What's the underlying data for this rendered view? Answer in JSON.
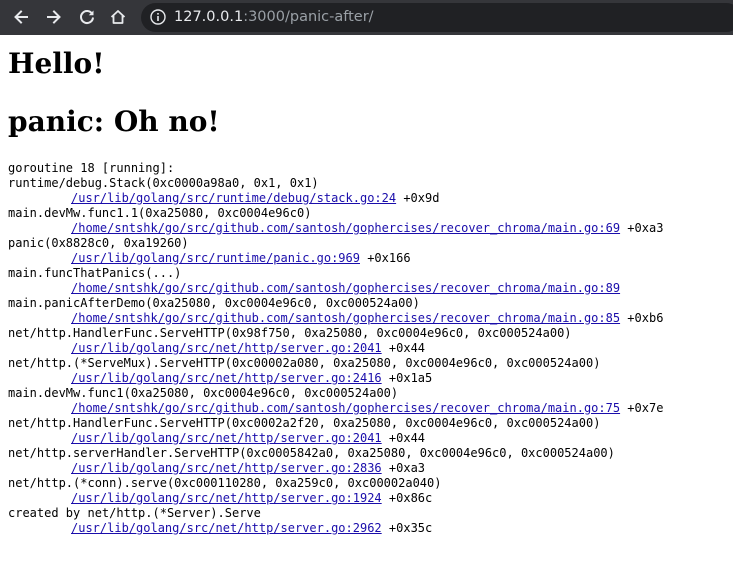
{
  "browser": {
    "url_host": "127.0.0.1",
    "url_rest": ":3000/panic-after/",
    "icons": {
      "back": "back-arrow-icon",
      "forward": "forward-arrow-icon",
      "reload": "reload-icon",
      "home": "home-icon",
      "site_info": "info-icon"
    }
  },
  "page": {
    "heading1": "Hello!",
    "heading2": "panic: Oh no!",
    "trace_header": "goroutine 18 [running]:",
    "frames": [
      {
        "func": "runtime/debug.Stack(0xc0000a98a0, 0x1, 0x1)",
        "file": "/usr/lib/golang/src/runtime/debug/stack.go:24",
        "offset": "+0x9d"
      },
      {
        "func": "main.devMw.func1.1(0xa25080, 0xc0004e96c0)",
        "file": "/home/sntshk/go/src/github.com/santosh/gophercises/recover_chroma/main.go:69",
        "offset": "+0xa3"
      },
      {
        "func": "panic(0x8828c0, 0xa19260)",
        "file": "/usr/lib/golang/src/runtime/panic.go:969",
        "offset": "+0x166"
      },
      {
        "func": "main.funcThatPanics(...)",
        "file": "/home/sntshk/go/src/github.com/santosh/gophercises/recover_chroma/main.go:89",
        "offset": ""
      },
      {
        "func": "main.panicAfterDemo(0xa25080, 0xc0004e96c0, 0xc000524a00)",
        "file": "/home/sntshk/go/src/github.com/santosh/gophercises/recover_chroma/main.go:85",
        "offset": "+0xb6"
      },
      {
        "func": "net/http.HandlerFunc.ServeHTTP(0x98f750, 0xa25080, 0xc0004e96c0, 0xc000524a00)",
        "file": "/usr/lib/golang/src/net/http/server.go:2041",
        "offset": "+0x44"
      },
      {
        "func": "net/http.(*ServeMux).ServeHTTP(0xc00002a080, 0xa25080, 0xc0004e96c0, 0xc000524a00)",
        "file": "/usr/lib/golang/src/net/http/server.go:2416",
        "offset": "+0x1a5"
      },
      {
        "func": "main.devMw.func1(0xa25080, 0xc0004e96c0, 0xc000524a00)",
        "file": "/home/sntshk/go/src/github.com/santosh/gophercises/recover_chroma/main.go:75",
        "offset": "+0x7e"
      },
      {
        "func": "net/http.HandlerFunc.ServeHTTP(0xc0002a2f20, 0xa25080, 0xc0004e96c0, 0xc000524a00)",
        "file": "/usr/lib/golang/src/net/http/server.go:2041",
        "offset": "+0x44"
      },
      {
        "func": "net/http.serverHandler.ServeHTTP(0xc0005842a0, 0xa25080, 0xc0004e96c0, 0xc000524a00)",
        "file": "/usr/lib/golang/src/net/http/server.go:2836",
        "offset": "+0xa3"
      },
      {
        "func": "net/http.(*conn).serve(0xc000110280, 0xa259c0, 0xc00002a040)",
        "file": "/usr/lib/golang/src/net/http/server.go:1924",
        "offset": "+0x86c"
      },
      {
        "func": "created by net/http.(*Server).Serve",
        "file": "/usr/lib/golang/src/net/http/server.go:2962",
        "offset": "+0x35c"
      }
    ]
  }
}
